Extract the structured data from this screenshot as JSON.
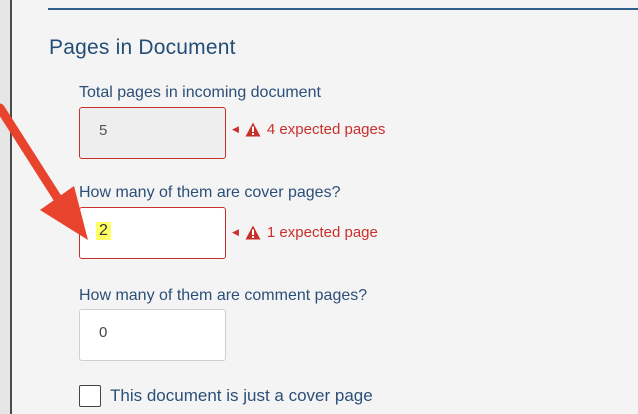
{
  "section": {
    "title": "Pages in Document"
  },
  "fields": [
    {
      "label": "Total pages in incoming document",
      "value": "5",
      "state": "disabled-error",
      "message": "4 expected pages"
    },
    {
      "label": "How many of them are cover pages?",
      "value": "2",
      "state": "active-error",
      "message": "1 expected page"
    },
    {
      "label": "How many of them are comment pages?",
      "value": "0",
      "state": "normal"
    }
  ],
  "checkbox": {
    "label": "This document is just a cover page",
    "checked": false
  },
  "colors": {
    "accent": "#234e76",
    "error": "#c9302c",
    "highlight": "#ffff66",
    "arrow": "#e8432c"
  },
  "icons": {
    "warning": "warning-triangle-icon",
    "caret": "caret-left-icon",
    "annotation": "red-arrow-annotation"
  }
}
